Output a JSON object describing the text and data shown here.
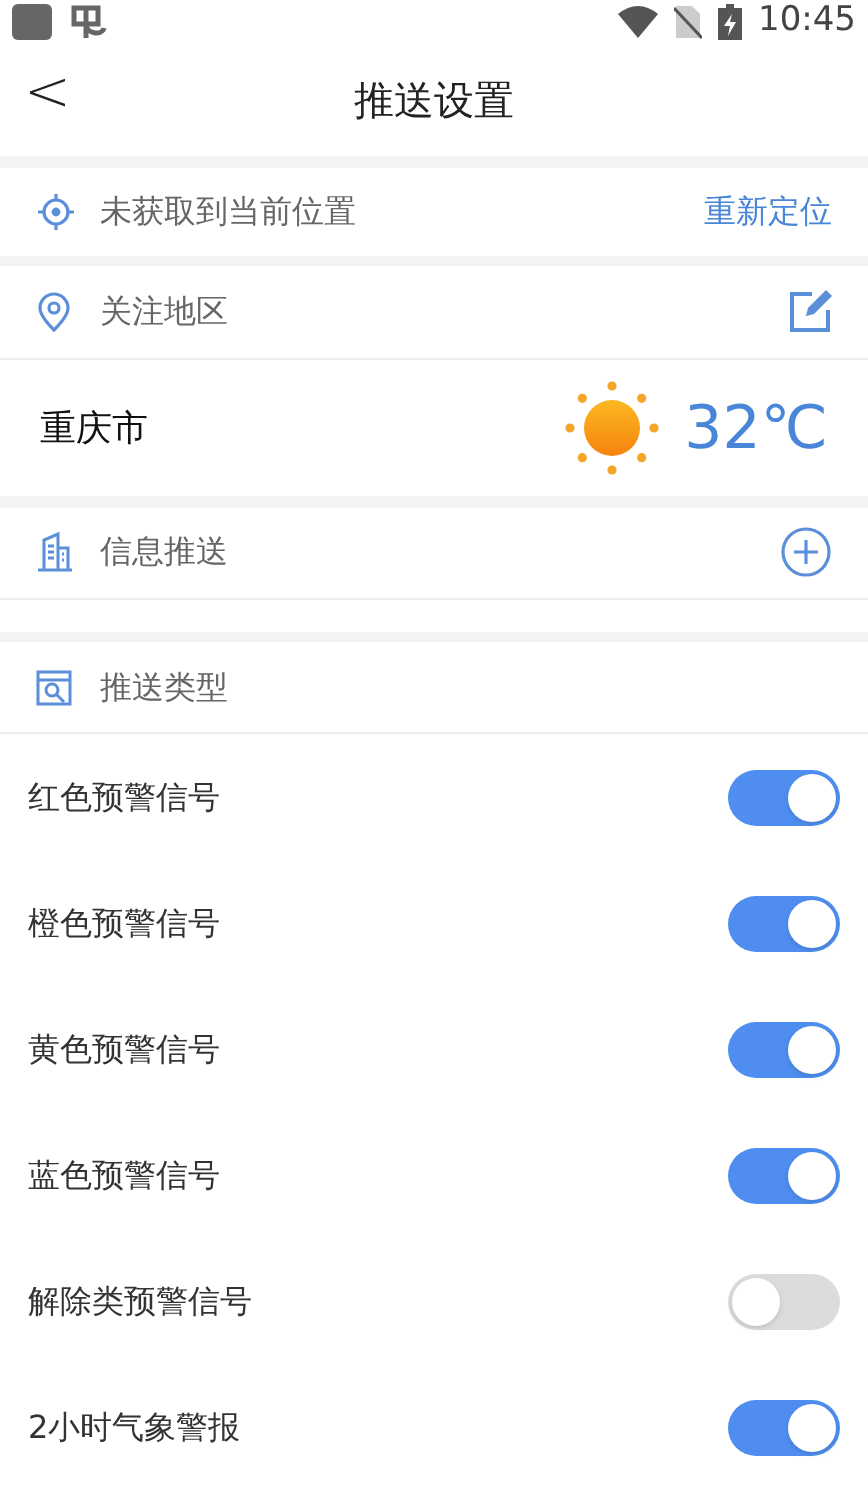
{
  "status_bar": {
    "time": "10:45"
  },
  "header": {
    "back": "<",
    "title": "推送设置"
  },
  "location": {
    "label": "未获取到当前位置",
    "action": "重新定位"
  },
  "region": {
    "label": "关注地区",
    "city": "重庆市",
    "temperature": "32℃"
  },
  "info_push": {
    "label": "信息推送"
  },
  "push_types": {
    "label": "推送类型",
    "items": [
      {
        "label": "红色预警信号",
        "on": true
      },
      {
        "label": "橙色预警信号",
        "on": true
      },
      {
        "label": "黄色预警信号",
        "on": true
      },
      {
        "label": "蓝色预警信号",
        "on": true
      },
      {
        "label": "解除类预警信号",
        "on": false
      },
      {
        "label": "2小时气象警报",
        "on": true
      }
    ]
  }
}
